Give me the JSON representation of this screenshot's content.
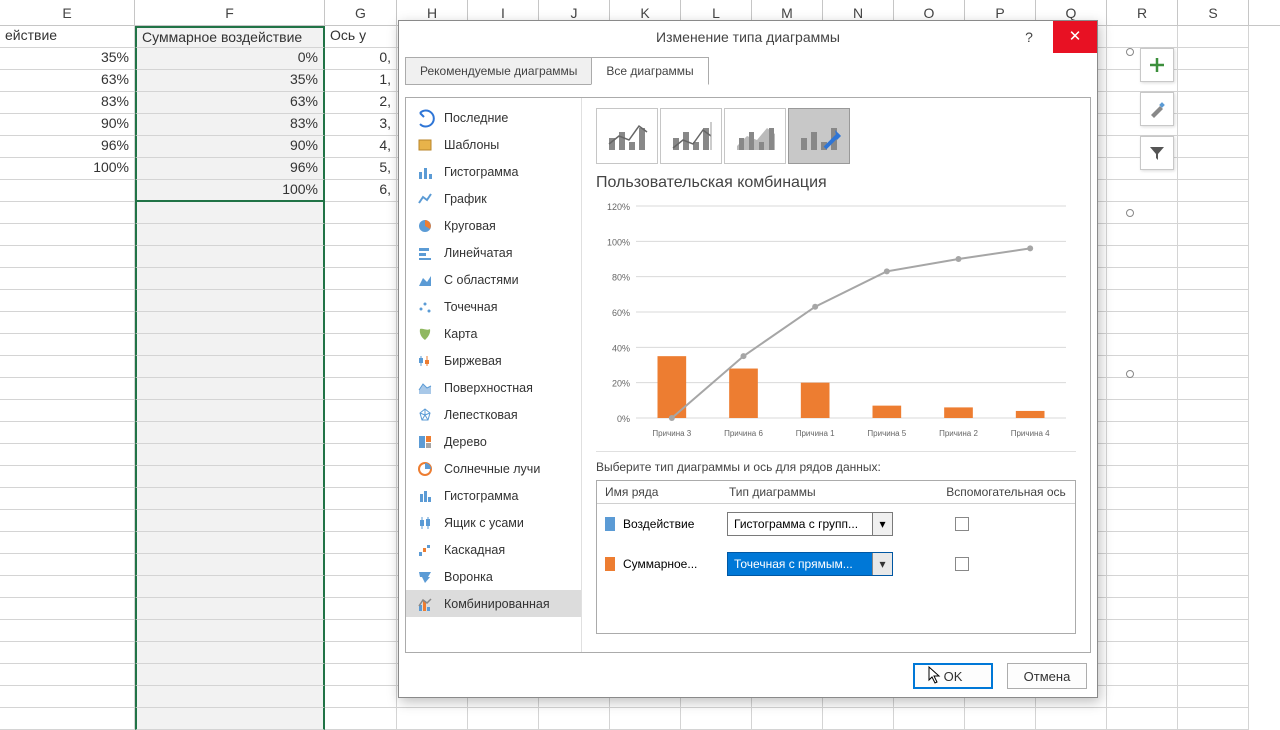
{
  "columns": [
    "E",
    "F",
    "G",
    "H",
    "I",
    "J",
    "K",
    "L",
    "M",
    "N",
    "O",
    "P",
    "Q",
    "R",
    "S"
  ],
  "headerRow": {
    "E": "ействие",
    "F": "Суммарное воздействие",
    "G": "Ось y"
  },
  "dataRows": [
    {
      "E": "35%",
      "F": "0%",
      "G": "0,"
    },
    {
      "E": "63%",
      "F": "35%",
      "G": "1,"
    },
    {
      "E": "83%",
      "F": "63%",
      "G": "2,"
    },
    {
      "E": "90%",
      "F": "83%",
      "G": "3,"
    },
    {
      "E": "96%",
      "F": "90%",
      "G": "4,"
    },
    {
      "E": "100%",
      "F": "96%",
      "G": "5,"
    },
    {
      "E": "",
      "F": "100%",
      "G": "6,"
    }
  ],
  "dialog": {
    "title": "Изменение типа диаграммы",
    "help": "?",
    "close": "✕",
    "tabs": {
      "recommended": "Рекомендуемые диаграммы",
      "all": "Все диаграммы"
    },
    "chartTypes": [
      "Последние",
      "Шаблоны",
      "Гистограмма",
      "График",
      "Круговая",
      "Линейчатая",
      "С областями",
      "Точечная",
      "Карта",
      "Биржевая",
      "Поверхностная",
      "Лепестковая",
      "Дерево",
      "Солнечные лучи",
      "Гистограмма",
      "Ящик с усами",
      "Каскадная",
      "Воронка",
      "Комбинированная"
    ],
    "selectedType": 18,
    "previewTitle": "Пользовательская комбинация",
    "seriesPrompt": "Выберите тип диаграммы и ось для рядов данных:",
    "seriesHeaders": {
      "name": "Имя ряда",
      "type": "Тип диаграммы",
      "aux": "Вспомогательная ось"
    },
    "series": [
      {
        "color": "#5b9bd5",
        "name": "Воздействие",
        "type": "Гистограмма с групп...",
        "aux": false,
        "active": false
      },
      {
        "color": "#ed7d31",
        "name": "Суммарное...",
        "type": "Точечная с прямым...",
        "aux": false,
        "active": true
      }
    ],
    "buttons": {
      "ok": "OK",
      "cancel": "Отмена"
    }
  },
  "chartTools": {
    "plus": "+",
    "brush": "brush",
    "filter": "filter"
  },
  "chart_data": {
    "type": "combo",
    "title": "Пользовательская комбинация",
    "ylabel": "",
    "ylim": [
      0,
      120
    ],
    "yticks": [
      0,
      20,
      40,
      60,
      80,
      100,
      120
    ],
    "categories": [
      "Причина 3",
      "Причина 6",
      "Причина 1",
      "Причина 5",
      "Причина 2",
      "Причина 4"
    ],
    "series": [
      {
        "name": "Воздействие",
        "type": "bar",
        "color": "#ed7d31",
        "values": [
          35,
          28,
          20,
          7,
          6,
          4
        ]
      },
      {
        "name": "Суммарное воздействие",
        "type": "line",
        "color": "#a6a6a6",
        "values": [
          0,
          35,
          63,
          83,
          90,
          96
        ]
      }
    ]
  }
}
